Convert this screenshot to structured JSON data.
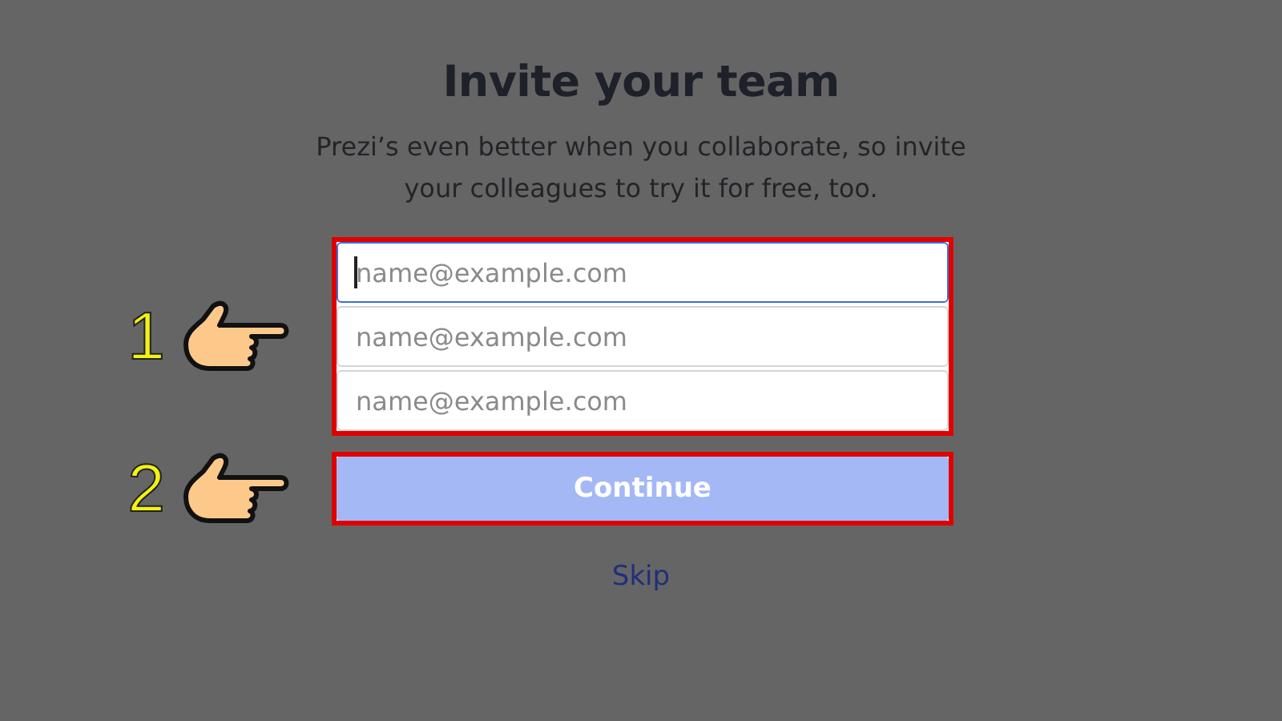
{
  "title": "Invite your team",
  "subtitle": "Prezi’s even better when you collaborate, so invite your colleagues to try it for free, too.",
  "email_fields": [
    {
      "placeholder": "name@example.com",
      "focused": true
    },
    {
      "placeholder": "name@example.com",
      "focused": false
    },
    {
      "placeholder": "name@example.com",
      "focused": false
    }
  ],
  "continue_button": {
    "label": "Continue",
    "disabled": true
  },
  "skip_link": "Skip",
  "step_markers": [
    {
      "number": "1"
    },
    {
      "number": "2"
    }
  ]
}
